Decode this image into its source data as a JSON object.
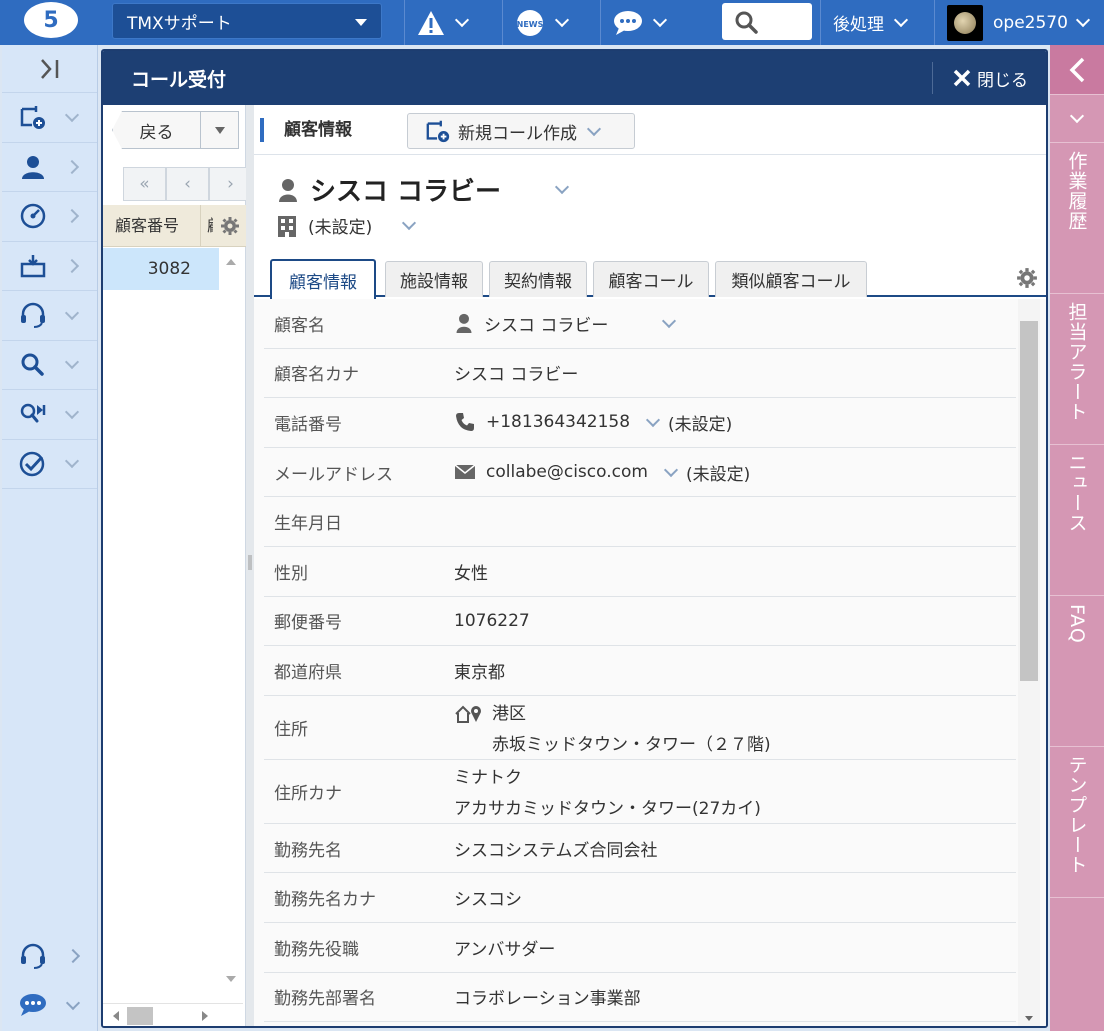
{
  "topbar": {
    "logo": "5",
    "tenant": "TMXサポート",
    "postproc_label": "後処理",
    "username": "ope2570"
  },
  "modal": {
    "title": "コール受付",
    "close_label": "閉じる"
  },
  "list": {
    "back_label": "戻る",
    "pager": [
      "«",
      "‹",
      "›"
    ],
    "col_number": "顧客番号",
    "col_second": "顧",
    "rows": [
      "3082"
    ]
  },
  "detail": {
    "toolbar_title": "顧客情報",
    "new_call_label": "新規コール作成",
    "customer_name": "シスコ コラビー",
    "facility": "(未設定)",
    "tabs": [
      "顧客情報",
      "施設情報",
      "契約情報",
      "顧客コール",
      "類似顧客コール"
    ],
    "active_tab": 0
  },
  "fields": {
    "name": {
      "label": "顧客名",
      "value": "シスコ コラビー"
    },
    "kana": {
      "label": "顧客名カナ",
      "value": "シスコ コラビー"
    },
    "phone": {
      "label": "電話番号",
      "value": "+181364342158",
      "extra": "(未設定)"
    },
    "email": {
      "label": "メールアドレス",
      "value": "collabe@cisco.com",
      "extra": "(未設定)"
    },
    "birthday": {
      "label": "生年月日",
      "value": ""
    },
    "gender": {
      "label": "性別",
      "value": "女性"
    },
    "postal": {
      "label": "郵便番号",
      "value": "1076227"
    },
    "prefecture": {
      "label": "都道府県",
      "value": "東京都"
    },
    "address": {
      "label": "住所",
      "line1": "港区",
      "line2": "赤坂ミッドタウン・タワー（２７階)"
    },
    "address_kana": {
      "label": "住所カナ",
      "line1": "ミナトク",
      "line2": "アカサカミッドタウン・タワー(27カイ)"
    },
    "company": {
      "label": "勤務先名",
      "value": "シスコシステムズ合同会社"
    },
    "company_kana": {
      "label": "勤務先名カナ",
      "value": "シスコシ"
    },
    "job_title": {
      "label": "勤務先役職",
      "value": "アンバサダー"
    },
    "department": {
      "label": "勤務先部署名",
      "value": "コラボレーション事業部"
    }
  },
  "rightbar": {
    "tabs": [
      "作業履歴",
      "担当アラート",
      "ニュース",
      "FAQ",
      "テンプレート"
    ]
  },
  "colors": {
    "topbar": "#2f6cc0",
    "modal_header": "#1d3f73",
    "rightbar": "#d597b4",
    "leftnav": "#d7e6f8",
    "selected_row": "#cce6fb"
  },
  "icons": {
    "top": [
      "logo",
      "alert-icon",
      "news-icon",
      "chat-icon",
      "search-icon",
      "avatar"
    ],
    "nav": [
      "new-call-icon",
      "person-icon",
      "dashboard-icon",
      "inbox-icon",
      "headset-icon",
      "search-icon",
      "call-search-icon",
      "check-icon"
    ]
  }
}
